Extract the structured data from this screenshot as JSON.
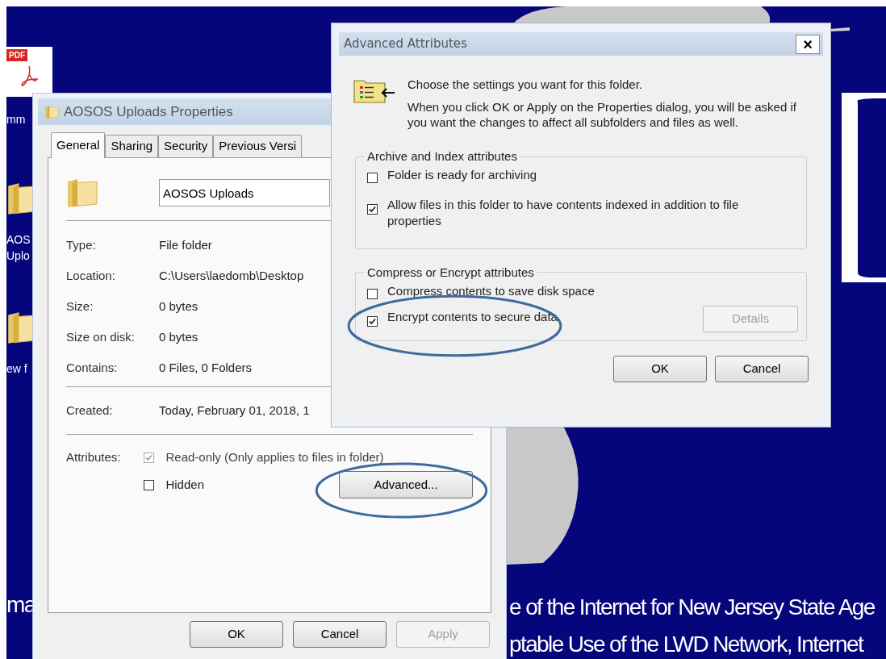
{
  "desktop": {
    "icons": [
      {
        "kind": "pdf",
        "badge": "PDF",
        "label": [
          "mm"
        ]
      },
      {
        "kind": "folder",
        "label": [
          "AOS",
          "Uplo"
        ]
      },
      {
        "kind": "folder",
        "label": [
          "ew f"
        ]
      }
    ],
    "wallpaper_text_left": "ma",
    "wallpaper_text_right": [
      "e of the Internet for New Jersey State Age",
      "ptable Use of the LWD Network, Internet"
    ]
  },
  "properties_window": {
    "title": "AOSOS Uploads Properties",
    "tabs": [
      {
        "label": "General",
        "selected": true
      },
      {
        "label": "Sharing",
        "selected": false
      },
      {
        "label": "Security",
        "selected": false
      },
      {
        "label": "Previous Versi",
        "selected": false
      }
    ],
    "name": "AOSOS Uploads",
    "detail_groups": [
      [
        {
          "label": "Type:",
          "value": "File folder"
        },
        {
          "label": "Location:",
          "value": "C:\\Users\\laedomb\\Desktop"
        },
        {
          "label": "Size:",
          "value": "0 bytes"
        },
        {
          "label": "Size on disk:",
          "value": "0 bytes"
        },
        {
          "label": "Contains:",
          "value": "0 Files, 0 Folders"
        }
      ],
      [
        {
          "label": "Created:",
          "value": "Today, February 01, 2018, 1"
        }
      ]
    ],
    "attributes": {
      "label": "Attributes:",
      "checkboxes": [
        {
          "label": "Read-only (Only applies to files in folder)",
          "checked": true,
          "disabled": true
        },
        {
          "label": "Hidden",
          "checked": false,
          "disabled": false
        }
      ],
      "advanced_button": {
        "label": "Advanced...",
        "circled": true
      }
    },
    "buttons": [
      {
        "label": "OK",
        "disabled": false
      },
      {
        "label": "Cancel",
        "disabled": false
      },
      {
        "label": "Apply",
        "disabled": true
      }
    ]
  },
  "advanced_window": {
    "title": "Advanced Attributes",
    "close": "×",
    "heading": "Choose the settings you want for this folder.",
    "description": "When you click OK or Apply on the Properties dialog, you will be asked if you want the changes to affect all subfolders and files as well.",
    "groups": [
      {
        "title": "Archive and Index attributes",
        "checkboxes": [
          {
            "label": "Folder is ready for archiving",
            "checked": false,
            "circled": false
          },
          {
            "label": "Allow files in this folder to have contents indexed in addition to file properties",
            "checked": true,
            "circled": false
          }
        ]
      },
      {
        "title": "Compress or Encrypt attributes",
        "checkboxes": [
          {
            "label": "Compress contents to save disk space",
            "checked": false,
            "circled": false
          },
          {
            "label": "Encrypt contents to secure data",
            "checked": true,
            "circled": true
          }
        ],
        "button": {
          "label": "Details",
          "disabled": true
        }
      }
    ],
    "buttons": [
      {
        "label": "OK",
        "disabled": false
      },
      {
        "label": "Cancel",
        "disabled": false
      }
    ]
  }
}
